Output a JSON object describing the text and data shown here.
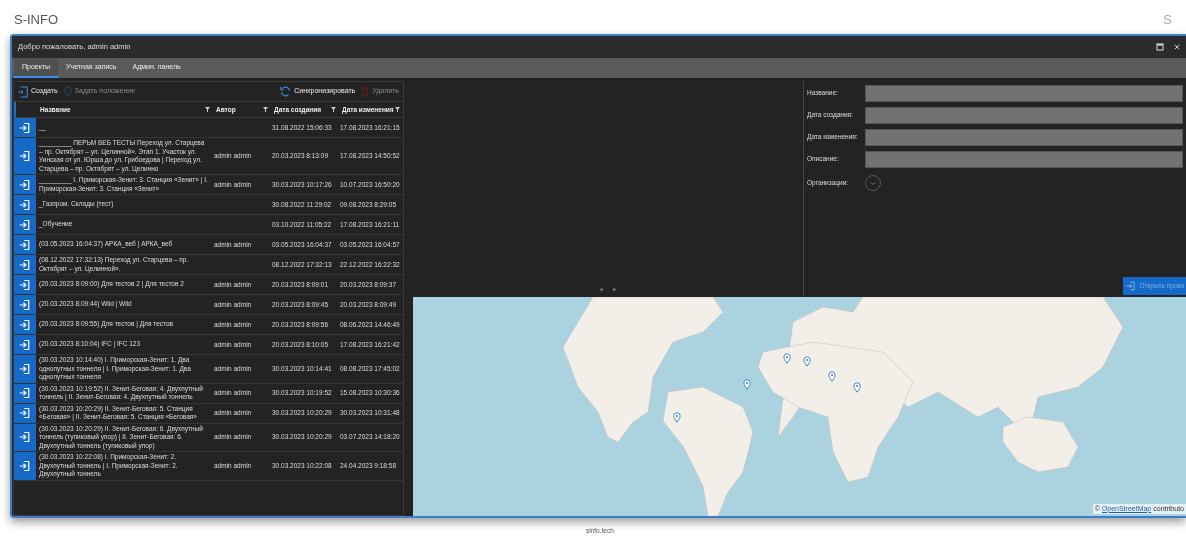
{
  "brand": "S-INFO",
  "brand_right": "S",
  "footer": "sinfo.tech",
  "window": {
    "title": "Добро пожаловать, admin admin"
  },
  "tabs": [
    {
      "label": "Проекты",
      "selected": true
    },
    {
      "label": "Учетная запись",
      "selected": false
    },
    {
      "label": "Админ. панель",
      "selected": false
    }
  ],
  "toolbar": [
    {
      "kind": "create",
      "label": "Создать",
      "disabled": false
    },
    {
      "kind": "locate",
      "label": "Задать положение",
      "disabled": true
    },
    {
      "kind": "sync",
      "label": "Синхронизировать",
      "disabled": false
    },
    {
      "kind": "delete",
      "label": "Удалить",
      "disabled": true
    }
  ],
  "table": {
    "columns": [
      "Название",
      "Автор",
      "Дата создания",
      "Дата изменения"
    ],
    "rows": [
      {
        "name": "__",
        "created": "31.08.2022 15:06:33",
        "modified": "17.08.2023 16:21:15"
      },
      {
        "name": "_________ ПЕРЬМ ВЕБ ТЕСТЫ Переход ул. Старцева – пр. Октябрят – ул. Целинной». Этап 1. Участок ул. Уинская от ул. Юрша до ул. Грибоедова | Переход ул. Старцева – пр. Октябрят – ул. Целинно",
        "author": "admin admin",
        "created": "20.03.2023 8:13:09",
        "modified": "17.08.2023 14:50:52"
      },
      {
        "name": "_________ I. Приморская-Зенит: 3. Станция «Зенит» | I. Приморская-Зенит: 3. Станция «Зенит»",
        "author": "admin admin",
        "created": "30.03.2023 10:17:26",
        "modified": "10.07.2023 16:50:20"
      },
      {
        "name": "_Газпром. Склады (тест)",
        "created": "30.08.2022 11:29:02",
        "modified": "09.08.2023 8:29:05"
      },
      {
        "name": "_Обучение",
        "created": "03.10.2022 11:05:22",
        "modified": "17.08.2023 16:21:11"
      },
      {
        "name": "(03.05.2023 16:04:37) АРКА_веб | АРКА_веб",
        "author": "admin admin",
        "created": "03.05.2023 16:04:37",
        "modified": "03.05.2023 16:04:57"
      },
      {
        "name": "(08.12.2022 17:32:13) Переход ул. Старцева – пр. Октябрят – ул. Целинной».",
        "created": "08.12.2022 17:32:13",
        "modified": "22.12.2022 16:22:32"
      },
      {
        "name": "(20.03.2023 8:09:00) Для тестов 2 | Для тестов 2",
        "author": "admin admin",
        "created": "20.03.2023 8:09:01",
        "modified": "20.03.2023 8:09:37"
      },
      {
        "name": "(20.03.2023 8:09:44) Wild | Wild",
        "author": "admin admin",
        "created": "20.03.2023 8:09:45",
        "modified": "20.03.2023 8:09:49"
      },
      {
        "name": "(20.03.2023 8:09:55) Для тестов | Для тестов",
        "author": "admin admin",
        "created": "20.03.2023 8:09:56",
        "modified": "08.06.2023 14:46:49"
      },
      {
        "name": "(20.03.2023 8:10:04) IFC | IFC 123",
        "author": "admin admin",
        "created": "20.03.2023 8:10:05",
        "modified": "17.08.2023 16:21:42"
      },
      {
        "name": "(30.03.2023 10:14:40) I. Приморская-Зенит: 1. Два однопутных тоннеля | I. Приморская-Зенит: 1. Два однопутных тоннеля",
        "author": "admin admin",
        "created": "30.03.2023 10:14:41",
        "modified": "08.08.2023 17:45:02"
      },
      {
        "name": "(30.03.2023 10:19:52) II. Зенит-Беговая: 4. Двухпутный тоннель | II. Зенит-Беговая: 4. Двухпутный тоннель",
        "author": "admin admin",
        "created": "30.03.2023 10:19:52",
        "modified": "15.08.2023 10:30:36"
      },
      {
        "name": "(30.03.2023 10:20:29) II. Зенит-Беговая: 5. Станция «Беговая» | II. Зенит-Беговая: 5. Станция «Беговая»",
        "author": "admin admin",
        "created": "30.03.2023 10:20:29",
        "modified": "30.03.2023 10:31:48"
      },
      {
        "name": "(30.03.2023 10:20:29) II. Зенит-Беговая: 6. Двухпутный тоннель (тупиковый упор) | II. Зенит-Беговая: 6. Двухпутный тоннель (тупиковый упор)",
        "author": "admin admin",
        "created": "30.03.2023 10:20:29",
        "modified": "03.07.2023 14:18:20"
      },
      {
        "name": "(30.03.2023 10:22:08) I. Приморская-Зенит: 2. Двухпутный тоннель | I. Приморская-Зенит: 2. Двухпутный тоннель",
        "author": "admin admin",
        "created": "30.03.2023 10:22:08",
        "modified": "24.04.2023 9:18:58"
      }
    ]
  },
  "viewer_nav": [
    "◀",
    "▶"
  ],
  "form": {
    "fields": [
      {
        "label": "Название:"
      },
      {
        "label": "Дата создания:"
      },
      {
        "label": "Дата изменения:"
      },
      {
        "label": "Описание:"
      }
    ],
    "organizations": {
      "label": "Организации:",
      "expanded": false
    },
    "open_button": {
      "label": "Открыть проек"
    }
  },
  "map": {
    "attribution_prefix": "©",
    "attribution_link": "OpenStreetMap",
    "attribution_suffix": "contributo"
  }
}
